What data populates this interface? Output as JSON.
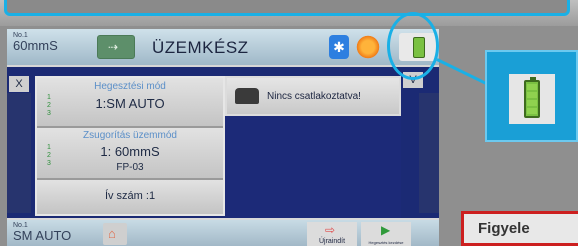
{
  "header": {
    "tag_small": "No.1",
    "tag_value": "60mmS",
    "title": "ÜZEMKÉSZ"
  },
  "panel": {
    "welding_mode_label": "Hegesztési mód",
    "welding_mode_value": "1:SM AUTO",
    "compression_label": "Zsugorítás üzemmód",
    "compression_value": "1: 60mmS",
    "compression_sub": "FP-03",
    "arc_count": "Ív szám :1"
  },
  "connection": {
    "status": "Nincs csatlakoztatva!"
  },
  "nav": {
    "close": "X",
    "dropdown": "V"
  },
  "footer": {
    "tag_small": "No.1",
    "tag_value": "SM AUTO",
    "restart_label": "Újraindít",
    "start_label": "Hegesztés kezdése"
  },
  "warning": {
    "text": "Figyele"
  },
  "colors": {
    "accent_callout": "#1ab0e6",
    "battery_green": "#7ac142",
    "warning_border": "#cc1f1f"
  },
  "icons": [
    "bluetooth-icon",
    "sun-icon",
    "battery-icon",
    "plug-icon",
    "home-icon",
    "restart-icon",
    "start-icon",
    "device-icon"
  ]
}
